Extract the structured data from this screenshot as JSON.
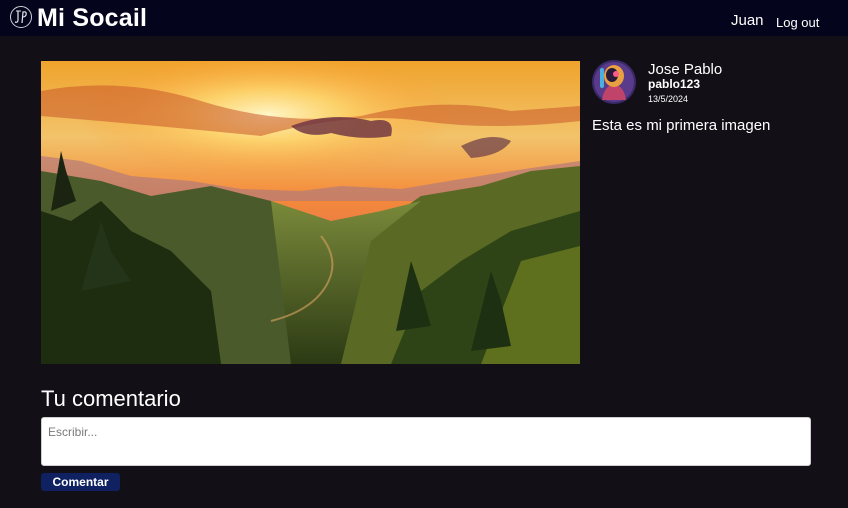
{
  "nav": {
    "brand": "Mi Socail",
    "user": "Juan",
    "logout_label": "Log out",
    "logo_icon": "jp-monogram-logo-icon"
  },
  "post": {
    "author": {
      "name": "Jose Pablo",
      "handle": "pablo123",
      "avatar_icon": "robot-avatar-icon"
    },
    "date": "13/5/2024",
    "caption": "Esta es mi primera imagen",
    "image": "mountain-sunset-valley-photo"
  },
  "comment": {
    "heading": "Tu comentario",
    "placeholder": "Escribir...",
    "value": "",
    "submit_label": "Comentar"
  },
  "colors": {
    "page_bg": "#121016",
    "navbar_bg": "#04041c",
    "button_bg": "#0f2160"
  }
}
